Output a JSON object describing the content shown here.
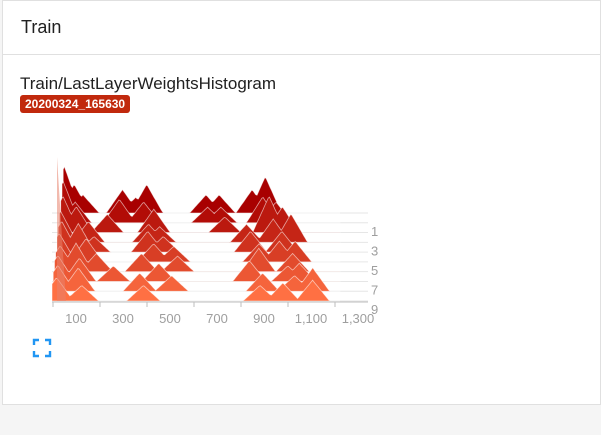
{
  "panel": {
    "title": "Train"
  },
  "card": {
    "title": "Train/LastLayerWeightsHistogram",
    "run": "20200324_165630"
  },
  "icons": {
    "expand": "fullscreen-icon"
  },
  "colors": {
    "badge": "#c1290d",
    "light": "#ff7043",
    "dark": "#a80000"
  },
  "chart_data": {
    "type": "histogram-offset",
    "x_ticks": [
      "100",
      "300",
      "500",
      "700",
      "900",
      "1,100",
      "1,300"
    ],
    "x_range": [
      40,
      1300
    ],
    "step_ticks": [
      "1",
      "3",
      "5",
      "7",
      "9"
    ],
    "step_range": [
      0,
      9
    ],
    "series": [
      {
        "step": 0,
        "peaks": [
          [
            45,
            0.9
          ],
          [
            90,
            0.55
          ],
          [
            130,
            0.35
          ],
          [
            310,
            0.45
          ],
          [
            370,
            0.3
          ],
          [
            420,
            0.55
          ],
          [
            690,
            0.35
          ],
          [
            750,
            0.35
          ],
          [
            900,
            0.45
          ],
          [
            960,
            0.7
          ]
        ]
      },
      {
        "step": 1,
        "peaks": [
          [
            45,
            0.8
          ],
          [
            100,
            0.4
          ],
          [
            300,
            0.45
          ],
          [
            410,
            0.4
          ],
          [
            700,
            0.3
          ],
          [
            760,
            0.3
          ],
          [
            950,
            0.5
          ],
          [
            1010,
            0.4
          ]
        ]
      },
      {
        "step": 2,
        "peaks": [
          [
            50,
            0.7
          ],
          [
            110,
            0.5
          ],
          [
            250,
            0.35
          ],
          [
            460,
            0.45
          ],
          [
            780,
            0.3
          ],
          [
            980,
            0.7
          ],
          [
            1040,
            0.5
          ]
        ]
      },
      {
        "step": 3,
        "peaks": [
          [
            45,
            0.6
          ],
          [
            170,
            0.4
          ],
          [
            440,
            0.35
          ],
          [
            490,
            0.3
          ],
          [
            880,
            0.35
          ],
          [
            1000,
            0.45
          ],
          [
            1080,
            0.55
          ]
        ]
      },
      {
        "step": 4,
        "peaks": [
          [
            55,
            0.6
          ],
          [
            130,
            0.55
          ],
          [
            200,
            0.3
          ],
          [
            440,
            0.4
          ],
          [
            510,
            0.3
          ],
          [
            900,
            0.4
          ],
          [
            1040,
            0.4
          ]
        ]
      },
      {
        "step": 5,
        "peaks": [
          [
            50,
            0.55
          ],
          [
            170,
            0.45
          ],
          [
            470,
            0.35
          ],
          [
            560,
            0.3
          ],
          [
            940,
            0.35
          ],
          [
            1030,
            0.4
          ],
          [
            1100,
            0.4
          ]
        ]
      },
      {
        "step": 6,
        "peaks": [
          [
            60,
            0.5
          ],
          [
            130,
            0.55
          ],
          [
            220,
            0.35
          ],
          [
            420,
            0.35
          ],
          [
            580,
            0.3
          ],
          [
            940,
            0.45
          ],
          [
            1090,
            0.35
          ]
        ]
      },
      {
        "step": 7,
        "peaks": [
          [
            55,
            0.5
          ],
          [
            150,
            0.45
          ],
          [
            300,
            0.3
          ],
          [
            500,
            0.35
          ],
          [
            900,
            0.4
          ],
          [
            1070,
            0.3
          ],
          [
            1120,
            0.35
          ]
        ]
      },
      {
        "step": 8,
        "peaks": [
          [
            60,
            0.5
          ],
          [
            150,
            0.45
          ],
          [
            420,
            0.35
          ],
          [
            560,
            0.3
          ],
          [
            960,
            0.35
          ],
          [
            1100,
            0.3
          ],
          [
            1180,
            0.45
          ]
        ]
      },
      {
        "step": 9,
        "peaks": [
          [
            60,
            0.45
          ],
          [
            170,
            0.3
          ],
          [
            440,
            0.3
          ],
          [
            950,
            0.3
          ],
          [
            1050,
            0.35
          ],
          [
            1180,
            0.4
          ]
        ]
      }
    ]
  }
}
